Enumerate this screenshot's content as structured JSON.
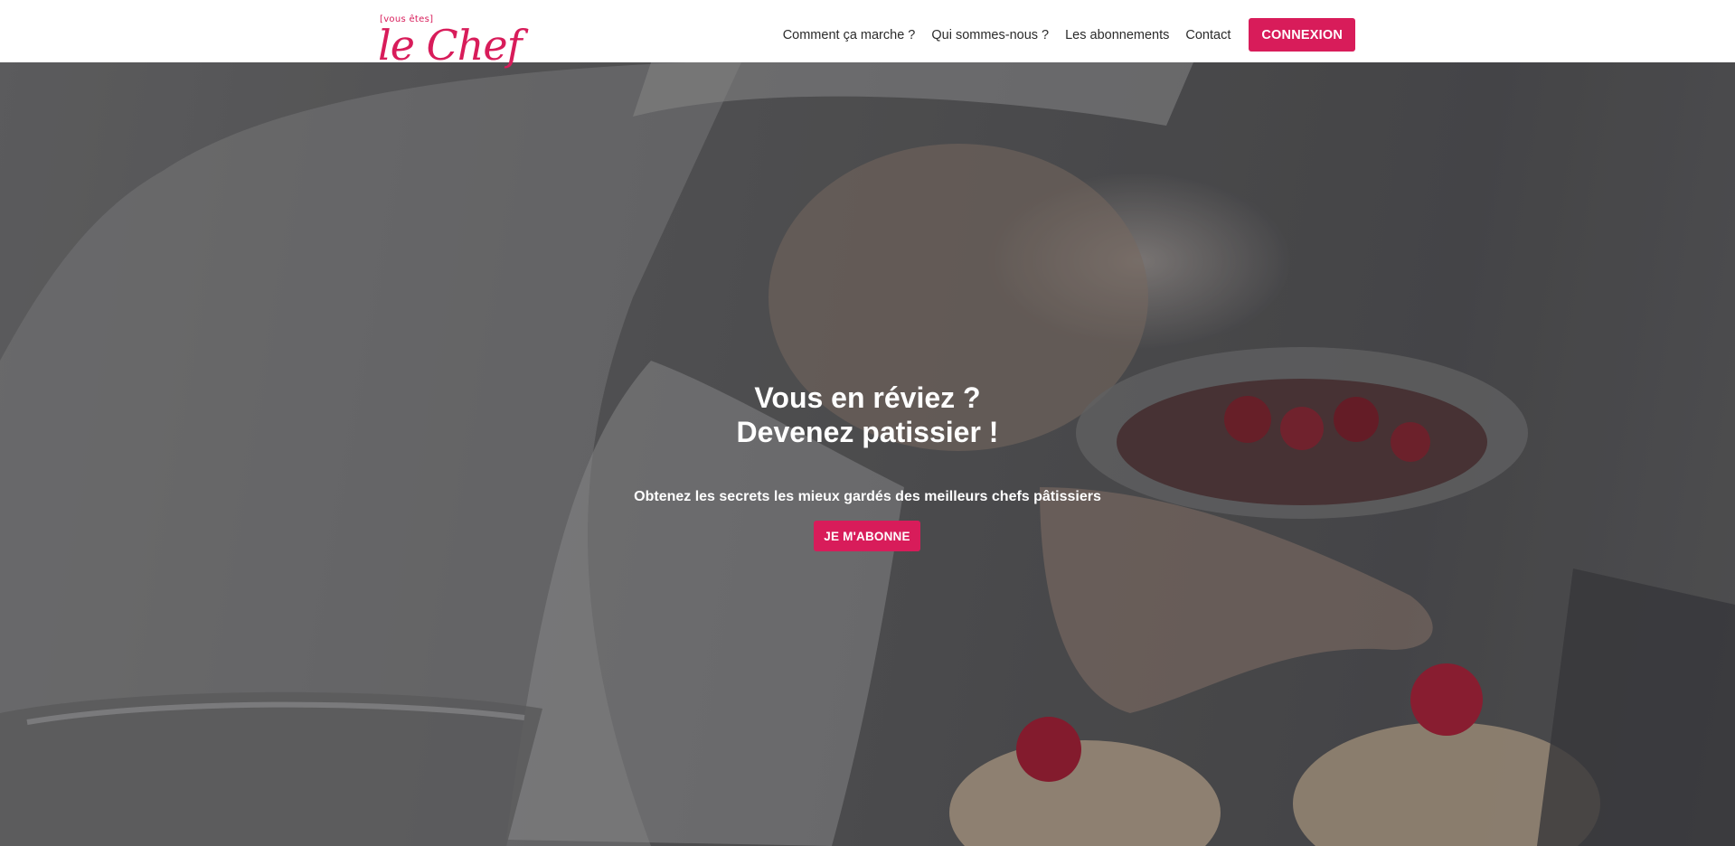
{
  "header": {
    "logo": {
      "tagline": "[vous êtes]",
      "name": "le Chef"
    },
    "nav": [
      {
        "label": "Comment ça marche ?"
      },
      {
        "label": "Qui sommes-nous ?"
      },
      {
        "label": "Les abonnements"
      },
      {
        "label": "Contact"
      }
    ],
    "cta_label": "CONNEXION"
  },
  "hero": {
    "title_line1": "Vous en réviez ?",
    "title_line2": "Devenez patissier !",
    "subtitle": "Obtenez les secrets les mieux gardés des meilleurs chefs pâtissiers",
    "cta_label": "JE M'ABONNE",
    "image": "chef-decorating-pastries-photo"
  },
  "colors": {
    "accent": "#d81c5a",
    "header_bg": "#ffffff",
    "nav_text": "#2b2b2b",
    "hero_text": "#ffffff"
  }
}
